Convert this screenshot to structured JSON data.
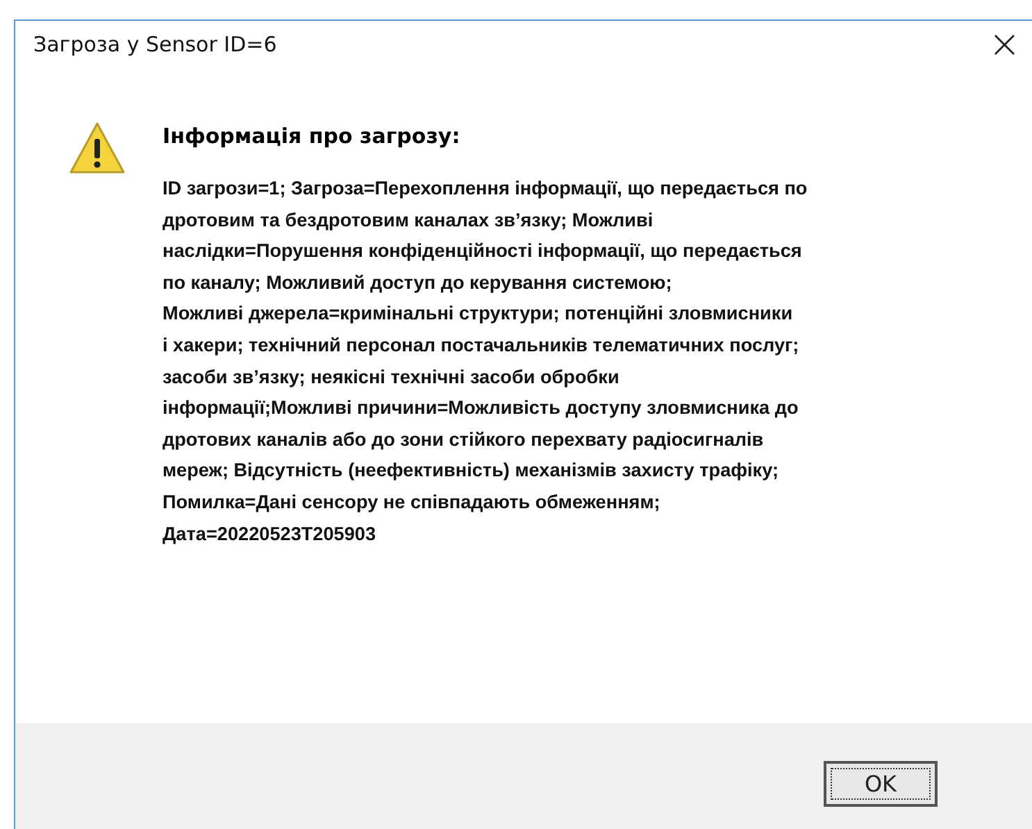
{
  "window": {
    "title": "Загроза у Sensor ID=6",
    "close": "×"
  },
  "message": {
    "heading": "Інформація про загрозу:",
    "body": "ID загрози=1; Загроза=Перехоплення інформації, що передається по\nдротовим та бездротовим каналах зв’язку; Можливі\nнаслідки=Порушення конфіденційності інформації, що передається\nпо каналу; Можливий доступ до керування системою;\nМожливі джерела=кримінальні структури; потенційні зловмисники\nі хакери; технічний персонал постачальників телематичних послуг;\nзасоби зв’язку; неякісні технічні засоби обробки\nінформації;Можливі причини=Можливість доступу зловмисника до\nдротових каналів або до зони стійкого перехвату радіосигналів\nмереж; Відсутність (неефективність) механізмів захисту трафіку;\nПомилка=Дані сенсору не співпадають обмеженням;\nДата=20220523T205903"
  },
  "buttons": [
    {
      "label": "OK",
      "focused": true
    }
  ]
}
